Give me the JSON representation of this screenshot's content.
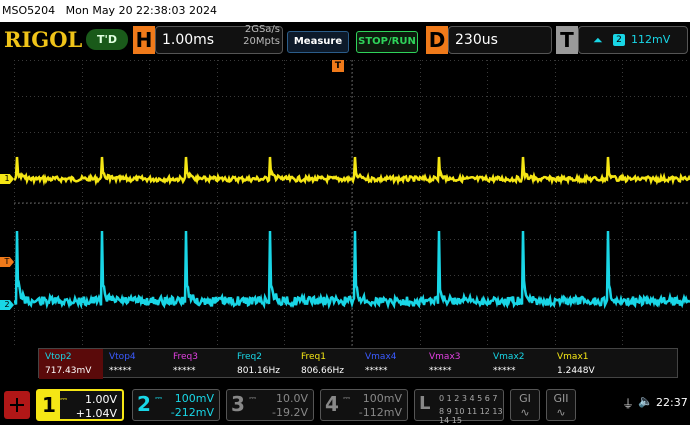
{
  "titlebar": {
    "model": "MSO5204",
    "datetime": "Mon May 20 22:38:03 2024"
  },
  "brand": {
    "logo": "RIGOL",
    "trigger_status": "T'D"
  },
  "horizontal": {
    "letter": "H",
    "scale": "1.00ms",
    "sample_rate": "2GSa/s",
    "mem_depth": "20Mpts"
  },
  "buttons": {
    "measure": "Measure",
    "stop_run": "STOP/RUN"
  },
  "delay": {
    "letter": "D",
    "value": "230us"
  },
  "trigger": {
    "letter": "T",
    "source": "2",
    "level": "112mV"
  },
  "channels": [
    {
      "num": "1",
      "scale": "1.00V",
      "offset": "+1.04V",
      "color": "#f5e615",
      "active": true
    },
    {
      "num": "2",
      "scale": "100mV",
      "offset": "-212mV",
      "color": "#19d6e6",
      "active": false
    },
    {
      "num": "3",
      "scale": "10.0V",
      "offset": "-19.2V",
      "color": "#888888",
      "active": false
    },
    {
      "num": "4",
      "scale": "100mV",
      "offset": "-112mV",
      "color": "#888888",
      "active": false
    }
  ],
  "measurements": [
    {
      "label": "Vtop2",
      "value": "717.43mV",
      "color": "#19d6e6",
      "highlight": true
    },
    {
      "label": "Vtop4",
      "value": "*****",
      "color": "#3b5bff"
    },
    {
      "label": "Freq3",
      "value": "*****",
      "color": "#e040e0"
    },
    {
      "label": "Freq2",
      "value": "801.16Hz",
      "color": "#19d6e6"
    },
    {
      "label": "Freq1",
      "value": "806.66Hz",
      "color": "#f5e615"
    },
    {
      "label": "Vmax4",
      "value": "*****",
      "color": "#3b5bff"
    },
    {
      "label": "Vmax3",
      "value": "*****",
      "color": "#e040e0"
    },
    {
      "label": "Vmax2",
      "value": "*****",
      "color": "#19d6e6"
    },
    {
      "label": "Vmax1",
      "value": "1.2448V",
      "color": "#f5e615"
    }
  ],
  "logic": {
    "letter": "L",
    "row1": "0 1 2 3 4 5 6 7",
    "row2": "8 9 10 11 12 13 14 15"
  },
  "gen": {
    "g1": "GI",
    "g2": "GII"
  },
  "status": {
    "time": "22:37"
  },
  "markers": {
    "ch1": "1",
    "ch2": "2",
    "trigger_pos": "T"
  },
  "colors": {
    "ch1": "#f5e615",
    "ch2": "#19d6e6",
    "grid": "#3a3a3a",
    "trig_marker": "#f07a1a"
  }
}
